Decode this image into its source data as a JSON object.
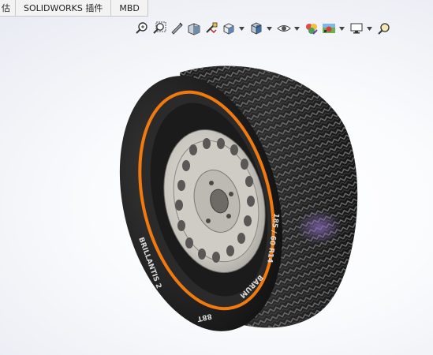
{
  "tabs": [
    {
      "label": "估"
    },
    {
      "label": "SOLIDWORKS 插件"
    },
    {
      "label": "MBD"
    }
  ],
  "toolbar": {
    "icons": [
      "zoom-to-fit-icon",
      "zoom-to-area-icon",
      "previous-view-icon",
      "section-view-icon",
      "dynamic-annotation-icon",
      "view-orientation-icon",
      "display-style-icon",
      "hide-show-items-icon",
      "edit-appearance-icon",
      "apply-scene-icon",
      "view-settings-icon",
      "search-icon"
    ]
  },
  "tire": {
    "sidewall_text_top": "185 / 60 R14",
    "sidewall_text_brand": "BARUM",
    "sidewall_text_bottom": "BRILLANTIS 2",
    "sidewall_text_index": "88T"
  },
  "colors": {
    "rim_ring": "#f07a10",
    "rubber": "#1e1e1e",
    "wheel": "#c9c6c1",
    "tread_highlight": "#7b5fa8"
  }
}
